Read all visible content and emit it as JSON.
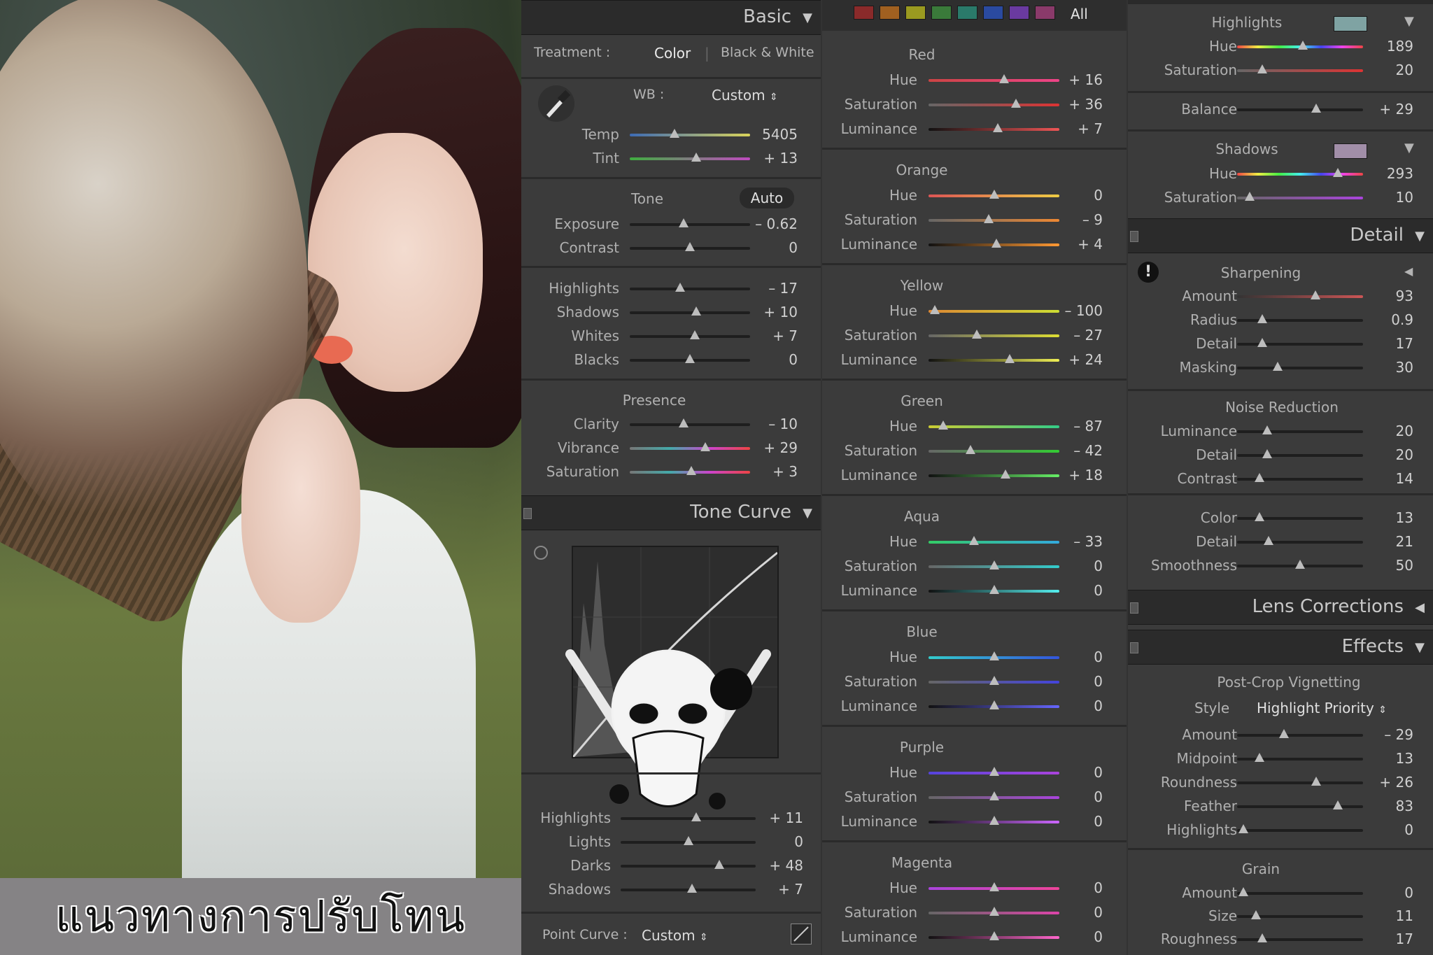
{
  "caption": "แนวทางการปรับโทน",
  "basic": {
    "title": "Basic",
    "treatment_label": "Treatment :",
    "treatment_color": "Color",
    "treatment_bw": "Black & White",
    "wb_label": "WB :",
    "wb_value": "Custom",
    "temp": {
      "label": "Temp",
      "value": "5405",
      "pos": 0.37
    },
    "tint": {
      "label": "Tint",
      "value": "+ 13",
      "pos": 0.55
    },
    "tone_label": "Tone",
    "auto_label": "Auto",
    "tone": [
      {
        "label": "Exposure",
        "value": "– 0.62",
        "pos": 0.45
      },
      {
        "label": "Contrast",
        "value": "0",
        "pos": 0.5
      }
    ],
    "tone2": [
      {
        "label": "Highlights",
        "value": "– 17",
        "pos": 0.42
      },
      {
        "label": "Shadows",
        "value": "+ 10",
        "pos": 0.55
      },
      {
        "label": "Whites",
        "value": "+ 7",
        "pos": 0.54
      },
      {
        "label": "Blacks",
        "value": "0",
        "pos": 0.5
      }
    ],
    "presence_label": "Presence",
    "presence": [
      {
        "label": "Clarity",
        "value": "– 10",
        "pos": 0.45
      },
      {
        "label": "Vibrance",
        "value": "+ 29",
        "pos": 0.63
      },
      {
        "label": "Saturation",
        "value": "+ 3",
        "pos": 0.51
      }
    ]
  },
  "tone_curve": {
    "title": "Tone Curve",
    "regions": [
      {
        "label": "Highlights",
        "value": "+ 11",
        "pos": 0.56
      },
      {
        "label": "Lights",
        "value": "0",
        "pos": 0.5
      },
      {
        "label": "Darks",
        "value": "+ 48",
        "pos": 0.73
      },
      {
        "label": "Shadows",
        "value": "+ 7",
        "pos": 0.53
      }
    ],
    "point_curve_label": "Point Curve :",
    "point_curve_value": "Custom"
  },
  "hsl": {
    "all_label": "All",
    "chip_colors": [
      "#8a2a2a",
      "#a06020",
      "#9a9a20",
      "#3a7a3a",
      "#2a7a6a",
      "#2a4aa0",
      "#6a3aa0",
      "#8a3a6a"
    ],
    "groups": [
      {
        "name": "Red",
        "rows": [
          {
            "label": "Hue",
            "value": "+ 16",
            "pos": 0.58
          },
          {
            "label": "Saturation",
            "value": "+ 36",
            "pos": 0.67
          },
          {
            "label": "Luminance",
            "value": "+ 7",
            "pos": 0.53
          }
        ]
      },
      {
        "name": "Orange",
        "rows": [
          {
            "label": "Hue",
            "value": "0",
            "pos": 0.5
          },
          {
            "label": "Saturation",
            "value": "– 9",
            "pos": 0.46
          },
          {
            "label": "Luminance",
            "value": "+ 4",
            "pos": 0.52
          }
        ]
      },
      {
        "name": "Yellow",
        "rows": [
          {
            "label": "Hue",
            "value": "– 100",
            "pos": 0.05
          },
          {
            "label": "Saturation",
            "value": "– 27",
            "pos": 0.37
          },
          {
            "label": "Luminance",
            "value": "+ 24",
            "pos": 0.62
          }
        ]
      },
      {
        "name": "Green",
        "rows": [
          {
            "label": "Hue",
            "value": "– 87",
            "pos": 0.11
          },
          {
            "label": "Saturation",
            "value": "– 42",
            "pos": 0.32
          },
          {
            "label": "Luminance",
            "value": "+ 18",
            "pos": 0.59
          }
        ]
      },
      {
        "name": "Aqua",
        "rows": [
          {
            "label": "Hue",
            "value": "– 33",
            "pos": 0.35
          },
          {
            "label": "Saturation",
            "value": "0",
            "pos": 0.5
          },
          {
            "label": "Luminance",
            "value": "0",
            "pos": 0.5
          }
        ]
      },
      {
        "name": "Blue",
        "rows": [
          {
            "label": "Hue",
            "value": "0",
            "pos": 0.5
          },
          {
            "label": "Saturation",
            "value": "0",
            "pos": 0.5
          },
          {
            "label": "Luminance",
            "value": "0",
            "pos": 0.5
          }
        ]
      },
      {
        "name": "Purple",
        "rows": [
          {
            "label": "Hue",
            "value": "0",
            "pos": 0.5
          },
          {
            "label": "Saturation",
            "value": "0",
            "pos": 0.5
          },
          {
            "label": "Luminance",
            "value": "0",
            "pos": 0.5
          }
        ]
      },
      {
        "name": "Magenta",
        "rows": [
          {
            "label": "Hue",
            "value": "0",
            "pos": 0.5
          },
          {
            "label": "Saturation",
            "value": "0",
            "pos": 0.5
          },
          {
            "label": "Luminance",
            "value": "0",
            "pos": 0.5
          }
        ]
      }
    ]
  },
  "split_toning": {
    "highlights_label": "Highlights",
    "highlights_swatch": "#7fa3a3",
    "highlights": [
      {
        "label": "Hue",
        "value": "189",
        "pos": 0.52
      },
      {
        "label": "Saturation",
        "value": "20",
        "pos": 0.2
      }
    ],
    "balance": {
      "label": "Balance",
      "value": "+ 29",
      "pos": 0.63
    },
    "shadows_label": "Shadows",
    "shadows_swatch": "#a18ea8",
    "shadows": [
      {
        "label": "Hue",
        "value": "293",
        "pos": 0.8
      },
      {
        "label": "Saturation",
        "value": "10",
        "pos": 0.1
      }
    ]
  },
  "detail": {
    "title": "Detail",
    "sharpening_label": "Sharpening",
    "sharpening": [
      {
        "label": "Amount",
        "value": "93",
        "pos": 0.62
      },
      {
        "label": "Radius",
        "value": "0.9",
        "pos": 0.2
      },
      {
        "label": "Detail",
        "value": "17",
        "pos": 0.2
      },
      {
        "label": "Masking",
        "value": "30",
        "pos": 0.32
      }
    ],
    "noise_label": "Noise Reduction",
    "noise": [
      {
        "label": "Luminance",
        "value": "20",
        "pos": 0.24
      },
      {
        "label": "Detail",
        "value": "20",
        "pos": 0.24
      },
      {
        "label": "Contrast",
        "value": "14",
        "pos": 0.18
      }
    ],
    "noise2": [
      {
        "label": "Color",
        "value": "13",
        "pos": 0.18
      },
      {
        "label": "Detail",
        "value": "21",
        "pos": 0.25
      },
      {
        "label": "Smoothness",
        "value": "50",
        "pos": 0.5
      }
    ]
  },
  "lens": {
    "title": "Lens Corrections"
  },
  "effects": {
    "title": "Effects",
    "vignette_label": "Post-Crop Vignetting",
    "style_label": "Style",
    "style_value": "Highlight Priority",
    "vignette": [
      {
        "label": "Amount",
        "value": "– 29",
        "pos": 0.37
      },
      {
        "label": "Midpoint",
        "value": "13",
        "pos": 0.18
      },
      {
        "label": "Roundness",
        "value": "+ 26",
        "pos": 0.63
      },
      {
        "label": "Feather",
        "value": "83",
        "pos": 0.8
      },
      {
        "label": "Highlights",
        "value": "0",
        "pos": 0.05
      }
    ],
    "grain_label": "Grain",
    "grain": [
      {
        "label": "Amount",
        "value": "0",
        "pos": 0.05
      },
      {
        "label": "Size",
        "value": "11",
        "pos": 0.15
      },
      {
        "label": "Roughness",
        "value": "17",
        "pos": 0.2
      }
    ]
  }
}
